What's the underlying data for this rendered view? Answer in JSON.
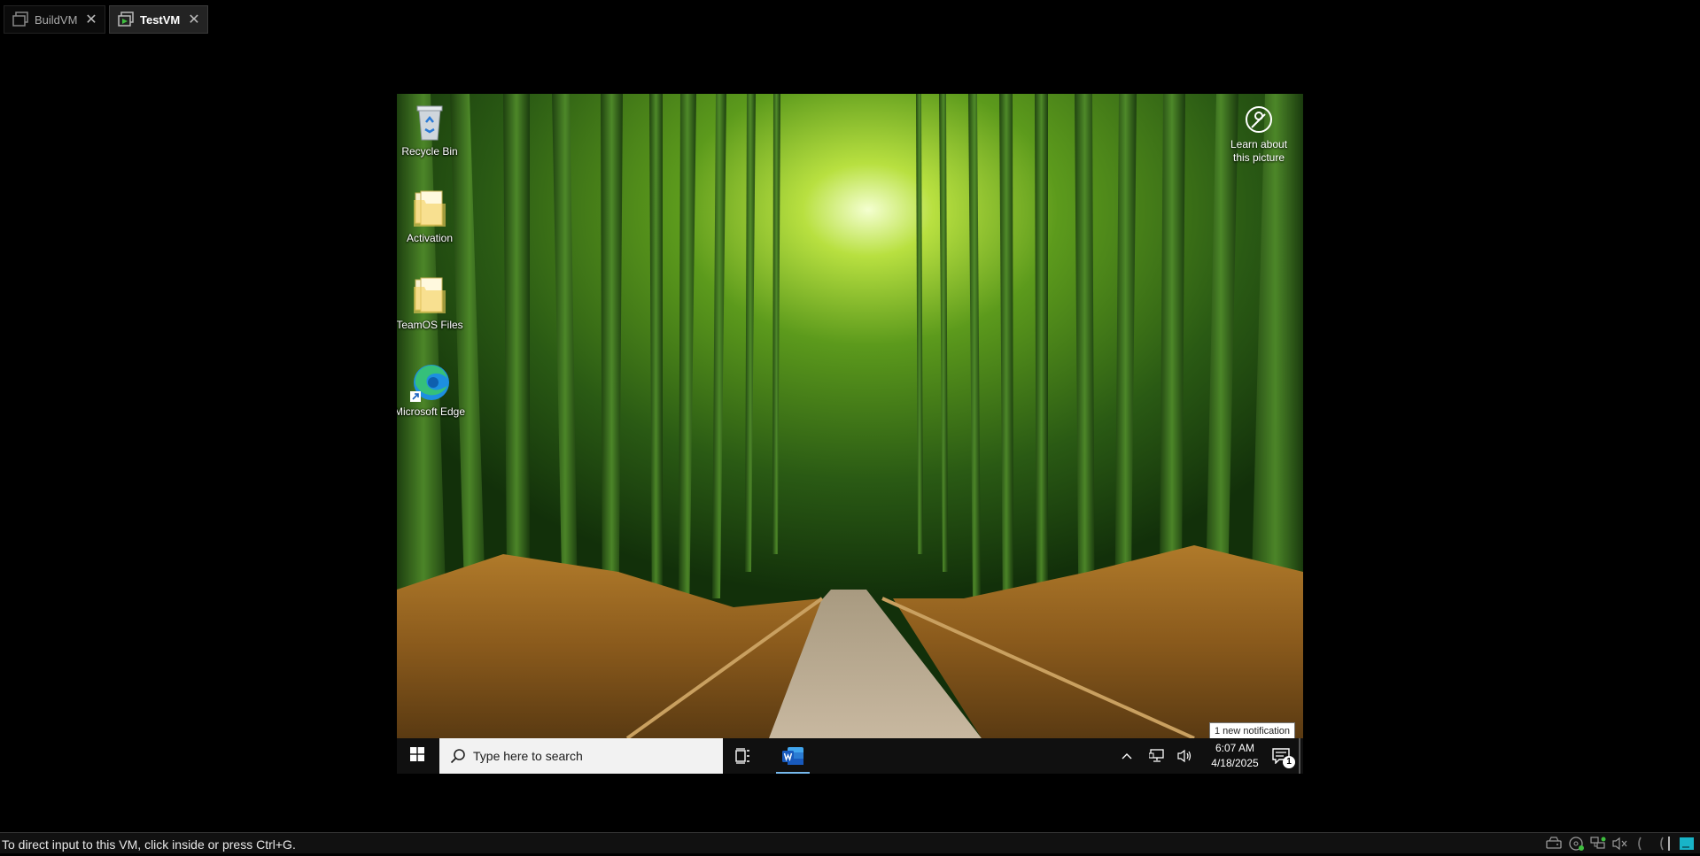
{
  "host": {
    "tabs": [
      {
        "label": "BuildVM",
        "active": false
      },
      {
        "label": "TestVM",
        "active": true
      }
    ],
    "status_message": "To direct input to this VM, click inside or press Ctrl+G.",
    "status_icons": [
      "removable-drive-icon",
      "optical-drive-icon",
      "network-adapter-icon",
      "audio-muted-icon",
      "usb-icon",
      "usb-icon",
      "vm-console-icon"
    ]
  },
  "vm": {
    "desktop_icons": [
      {
        "label": "Recycle Bin",
        "icon": "recycle-bin-icon"
      },
      {
        "label": "Activation",
        "icon": "folder-icon"
      },
      {
        "label": "TeamOS Files",
        "icon": "folder-icon"
      },
      {
        "label": "Microsoft Edge",
        "icon": "edge-icon"
      }
    ],
    "learn_about": "Learn about this picture",
    "notification_tooltip": "1 new notification",
    "taskbar": {
      "search_placeholder": "Type here to search",
      "time": "6:07 AM",
      "date": "4/18/2025",
      "notification_count": "1"
    }
  },
  "colors": {
    "accent": "#76b9ed",
    "taskbar": "#101010",
    "word_blue": "#185abd"
  }
}
